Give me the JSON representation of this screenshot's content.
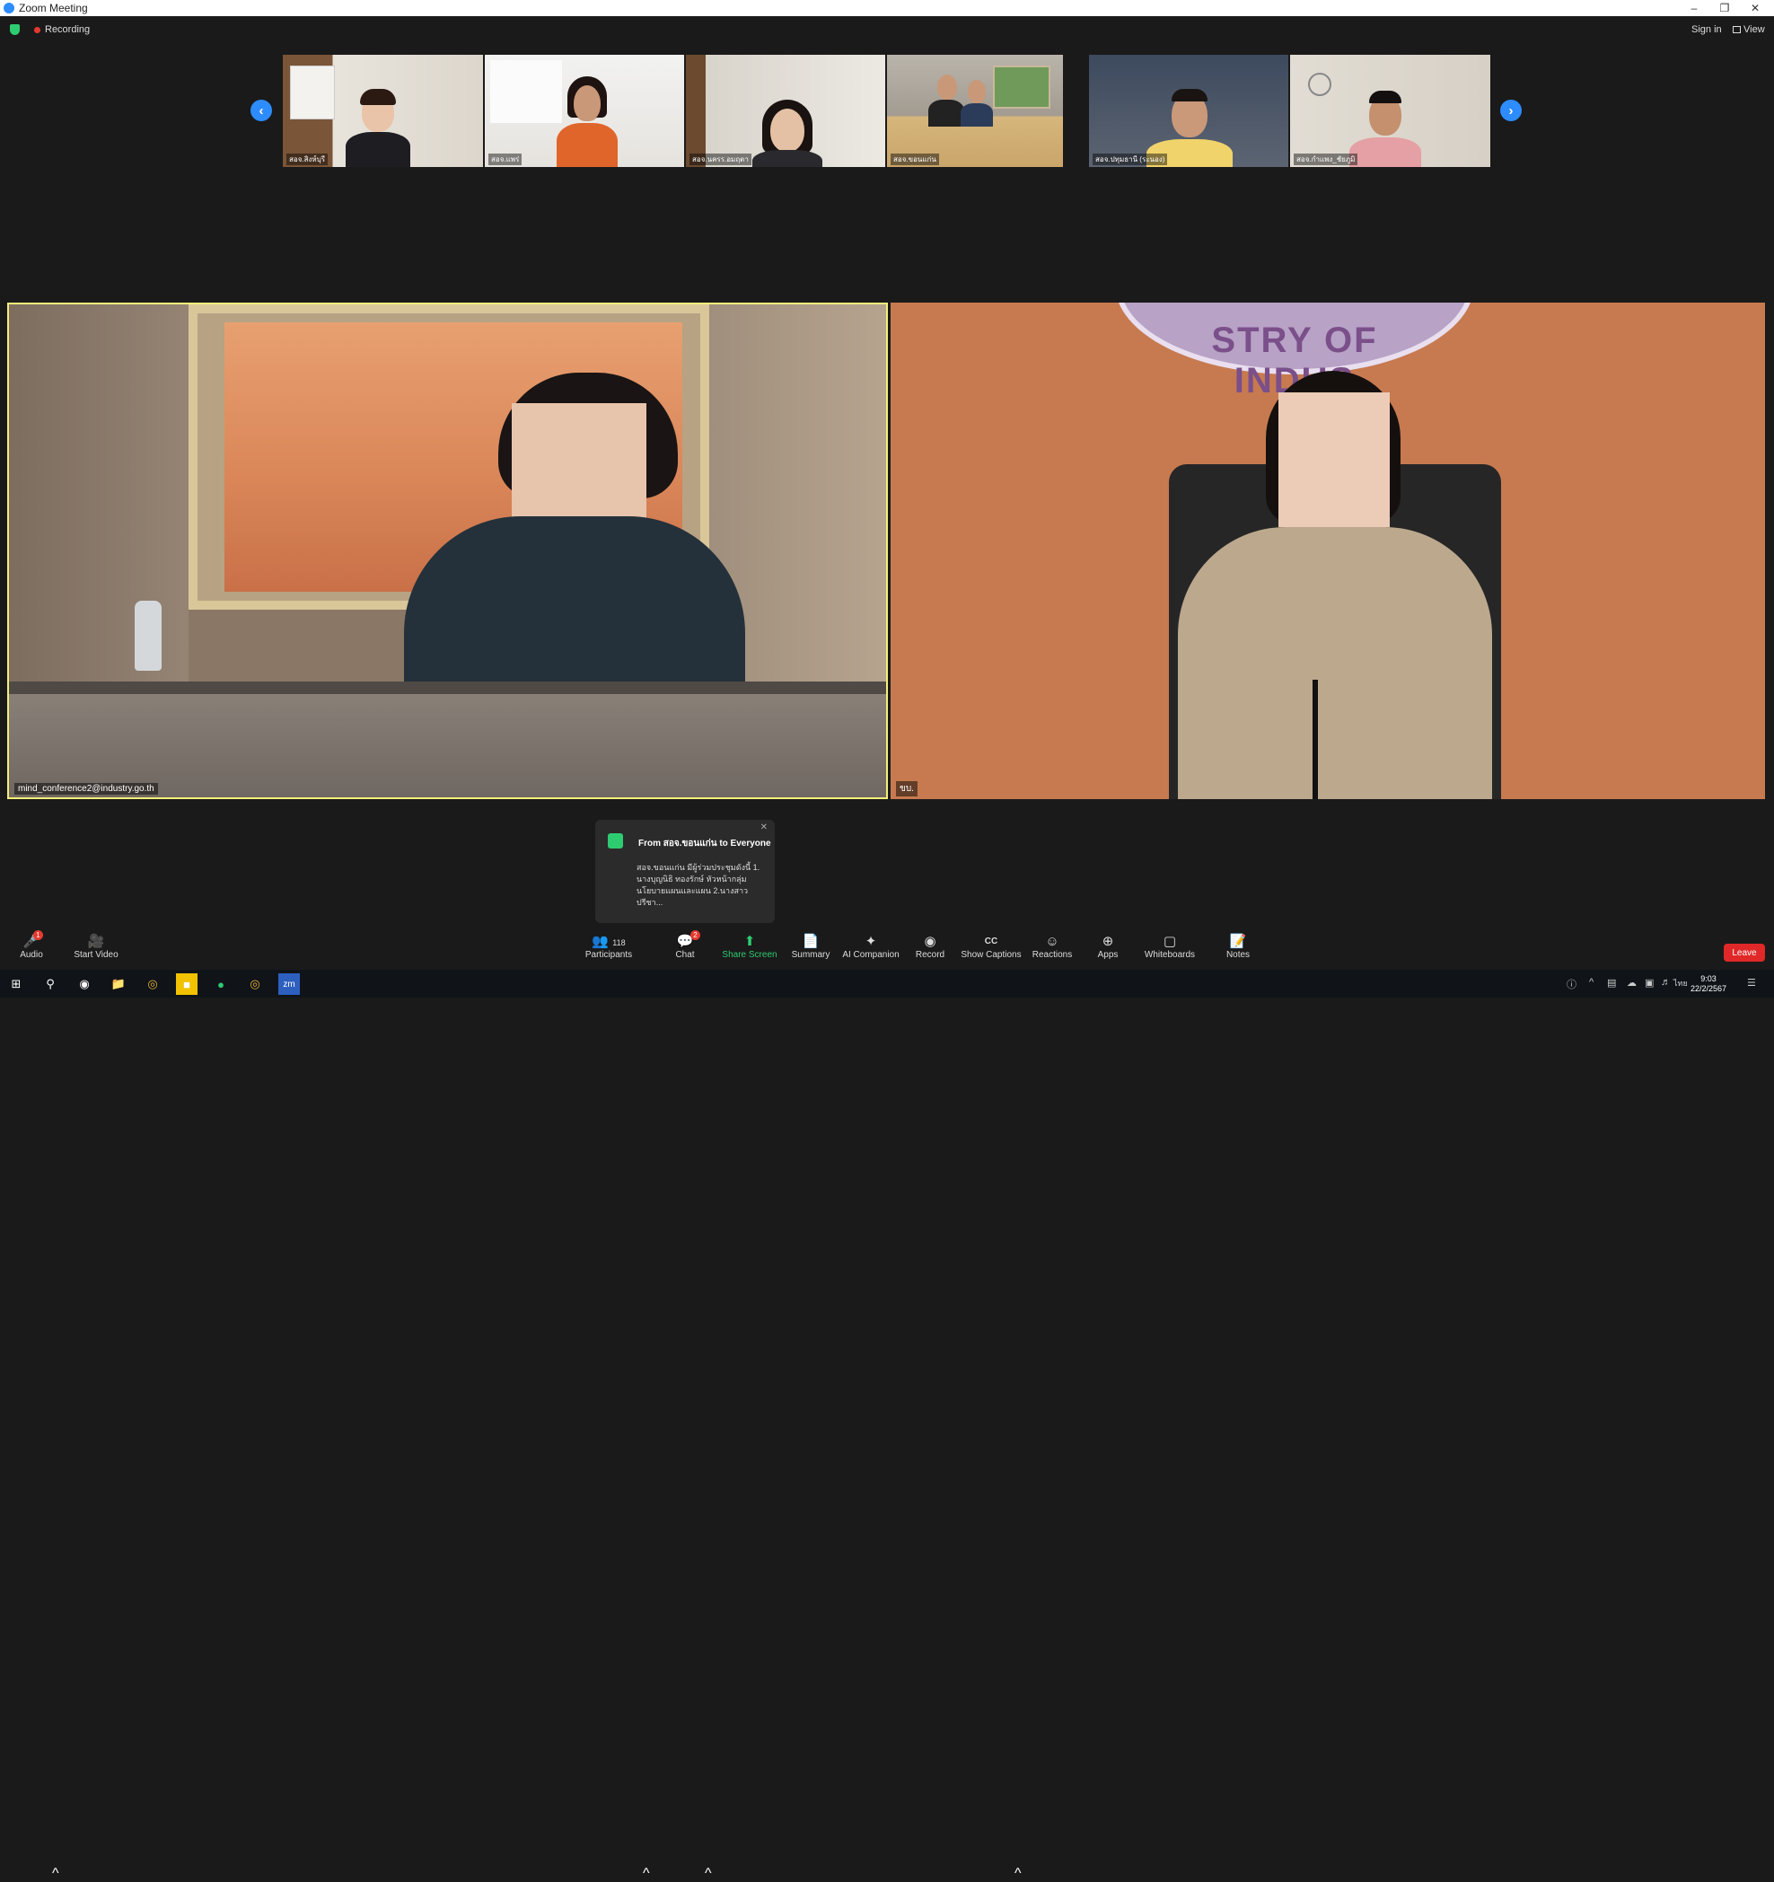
{
  "window": {
    "title": "Zoom Meeting"
  },
  "topbar": {
    "recording_label": "Recording",
    "sign_in": "Sign in",
    "view": "View"
  },
  "thumbnails": [
    {
      "name": "สอจ.สิงห์บุรี"
    },
    {
      "name": "สอจ.แพร่"
    },
    {
      "name": "สอจ.นครร.อมฤตา"
    },
    {
      "name": "สอจ.ขอนแก่น"
    },
    {
      "name": "สอจ.ปทุมธานี (ระนอง)"
    },
    {
      "name": "สอจ.กำแพง_ชัยภูมิ"
    }
  ],
  "main_videos": {
    "left_name": "mind_conference2@industry.go.th",
    "right_name": "ขบ.",
    "right_banner": "STRY OF INDUS"
  },
  "chat_popup": {
    "from": "From สอจ.ขอนแก่น to Everyone",
    "message": "สอจ.ขอนแก่น มีผู้ร่วมประชุมดังนี้ 1. นางบุญนิธิ ทองรักษ์ หัวหน้ากลุ่มนโยบายแผนและแผน 2.นางสาวปรีชา..."
  },
  "toolbar": {
    "audio": "Audio",
    "start_video": "Start Video",
    "participants": "Participants",
    "participants_count": "118",
    "chat": "Chat",
    "chat_badge": "2",
    "audio_badge": "1",
    "share_screen": "Share Screen",
    "summary": "Summary",
    "ai_companion": "AI Companion",
    "record": "Record",
    "show_captions": "Show Captions",
    "reactions": "Reactions",
    "apps": "Apps",
    "whiteboards": "Whiteboards",
    "notes": "Notes",
    "leave": "Leave"
  },
  "taskbar": {
    "time": "9:03",
    "date": "22/2/2567",
    "lang": "ไทย"
  },
  "colors": {
    "accent": "#2d8cff",
    "active_speaker": "#f4f07a",
    "leave": "#e02828",
    "share": "#2ecc71"
  }
}
